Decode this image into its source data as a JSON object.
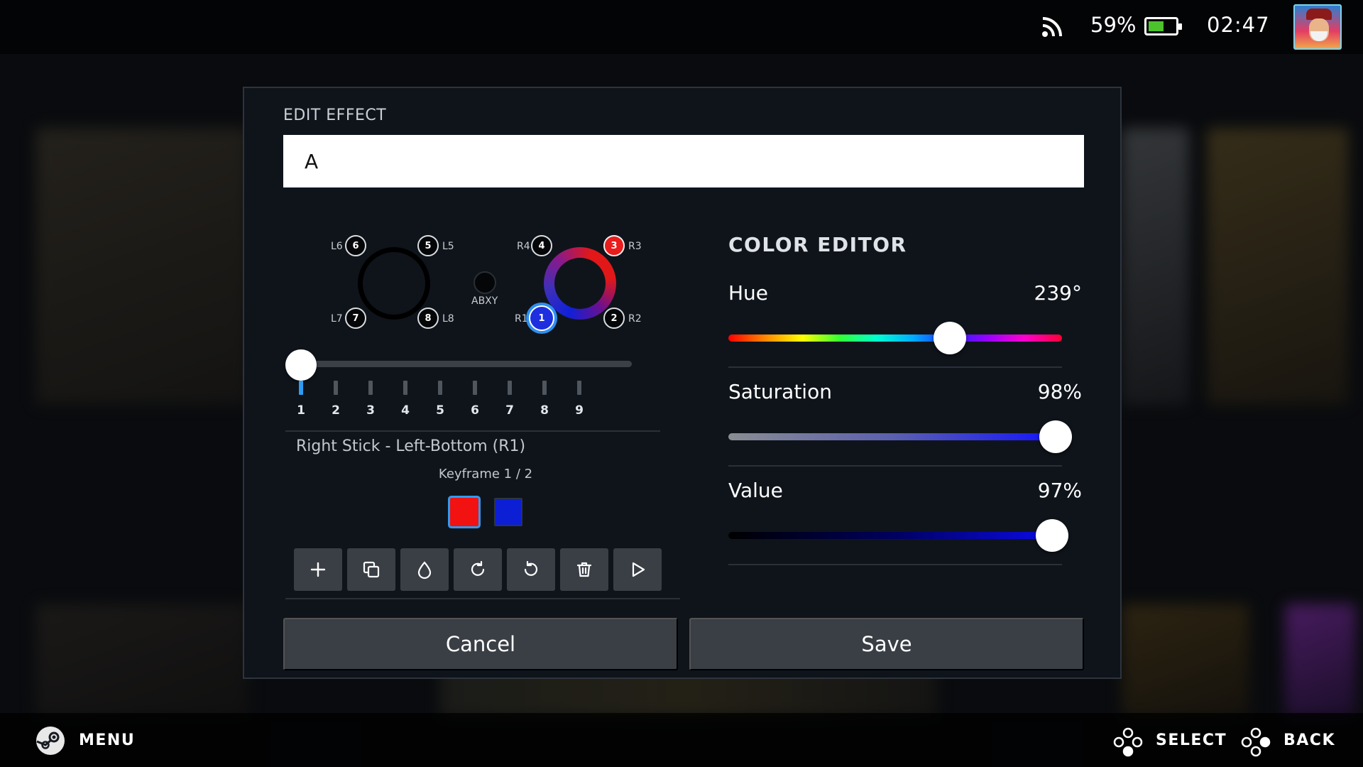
{
  "status_bar": {
    "battery_percent": "59%",
    "battery_level": 0.59,
    "clock": "02:47",
    "network_icon": "rss-icon"
  },
  "dialog": {
    "title": "EDIT EFFECT",
    "name_value": "A",
    "controller": {
      "left_leds": [
        {
          "num": "6",
          "tag": "L6"
        },
        {
          "num": "5",
          "tag": "L5"
        },
        {
          "num": "7",
          "tag": "L7"
        },
        {
          "num": "8",
          "tag": "L8"
        }
      ],
      "right_leds": [
        {
          "num": "4",
          "tag": "R4"
        },
        {
          "num": "3",
          "tag": "R3"
        },
        {
          "num": "1",
          "tag": "R1"
        },
        {
          "num": "2",
          "tag": "R2"
        }
      ],
      "abxy_label": "ABXY"
    },
    "keyframe_slider": {
      "ticks": [
        "1",
        "2",
        "3",
        "4",
        "5",
        "6",
        "7",
        "8",
        "9"
      ],
      "selected": 1
    },
    "selected_led_label": "Right Stick - Left-Bottom (R1)",
    "keyframe_counter": "Keyframe 1 / 2",
    "keyframe_colors": [
      "#f21212",
      "#0d1fd4"
    ],
    "toolbar": {
      "icons": [
        "plus-icon",
        "duplicate-icon",
        "droplet-icon",
        "rotate-cw-icon",
        "rotate-ccw-icon",
        "trash-icon",
        "play-icon"
      ]
    },
    "color_editor": {
      "title": "COLOR EDITOR",
      "hue_label": "Hue",
      "hue_value": "239°",
      "hue_fraction": 0.664,
      "saturation_label": "Saturation",
      "saturation_value": "98%",
      "saturation_fraction": 0.98,
      "value_label": "Value",
      "value_value": "97%",
      "value_fraction": 0.97
    },
    "cancel_label": "Cancel",
    "save_label": "Save"
  },
  "bottom_bar": {
    "menu_label": "MENU",
    "select_label": "SELECT",
    "back_label": "BACK"
  },
  "colors": {
    "accent": "#2e9cf2",
    "led_red": "#ea1c1c",
    "led_blue": "#1e2fe0",
    "panel": "#0f141b",
    "button": "#3a3f46"
  }
}
